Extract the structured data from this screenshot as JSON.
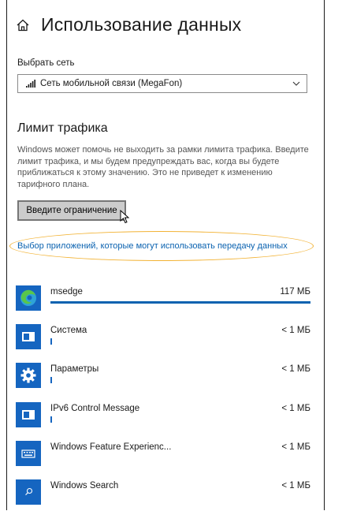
{
  "header": {
    "title": "Использование данных"
  },
  "network": {
    "label": "Выбрать сеть",
    "selected": "Сеть мобильной связи (MegaFon)"
  },
  "limit": {
    "heading": "Лимит трафика",
    "description": "Windows может помочь не выходить за рамки лимита трафика. Введите лимит трафика, и мы будем предупреждать вас, когда вы будете приближаться к этому значению. Это не приведет к изменению тарифного плана.",
    "button_label": "Введите ограничение"
  },
  "apps_link": "Выбор приложений, которые могут использовать передачу данных",
  "colors": {
    "accent": "#0a62b0",
    "highlight_ellipse": "#f2b233",
    "tile": "#1565c0"
  },
  "apps": [
    {
      "name": "msedge",
      "usage": "117 МБ",
      "usage_fraction": 1.0,
      "icon": "edge-icon"
    },
    {
      "name": "Система",
      "usage": "< 1 МБ",
      "usage_fraction": 0.005,
      "icon": "system-icon"
    },
    {
      "name": "Параметры",
      "usage": "< 1 МБ",
      "usage_fraction": 0.005,
      "icon": "gear-icon"
    },
    {
      "name": "IPv6 Control Message",
      "usage": "< 1 МБ",
      "usage_fraction": 0.005,
      "icon": "system-icon"
    },
    {
      "name": "Windows Feature Experienc...",
      "usage": "< 1 МБ",
      "usage_fraction": 0,
      "icon": "keyboard-icon"
    },
    {
      "name": "Windows Search",
      "usage": "< 1 МБ",
      "usage_fraction": 0,
      "icon": "search-icon"
    }
  ]
}
